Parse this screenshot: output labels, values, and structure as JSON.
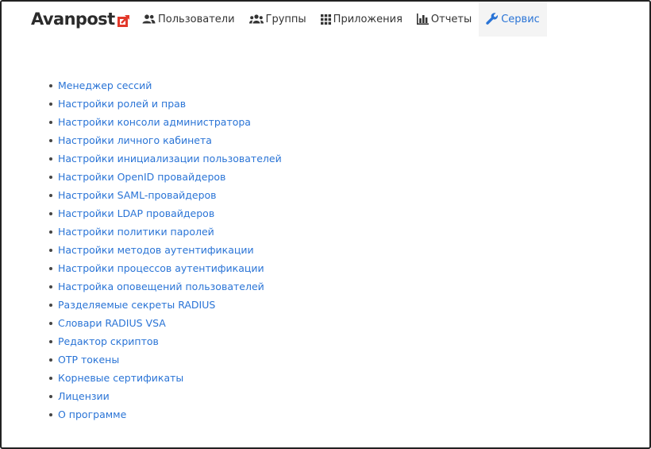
{
  "brand": {
    "name": "Avanpost",
    "accent": "#e2382a"
  },
  "nav": {
    "items": [
      {
        "label": "Пользователи",
        "icon": "users-icon"
      },
      {
        "label": "Группы",
        "icon": "groups-icon"
      },
      {
        "label": "Приложения",
        "icon": "apps-grid-icon"
      },
      {
        "label": "Отчеты",
        "icon": "bar-chart-icon"
      },
      {
        "label": "Сервис",
        "icon": "wrench-icon",
        "active": true
      }
    ],
    "active_color": "#2a74d6"
  },
  "service_menu": {
    "items": [
      "Менеджер сессий",
      "Настройки ролей и прав",
      "Настройки консоли администратора",
      "Настройки личного кабинета",
      "Настройки инициализации пользователей",
      "Настройки OpenID провайдеров",
      "Настройки SAML-провайдеров",
      "Настройки LDAP провайдеров",
      "Настройки политики паролей",
      "Настройки методов аутентификации",
      "Настройки процессов аутентификации",
      "Настройка оповещений пользователей",
      "Разделяемые секреты RADIUS",
      "Словари RADIUS VSA",
      "Редактор скриптов",
      "OTP токены",
      "Корневые сертификаты",
      "Лицензии",
      "О программе"
    ],
    "link_color": "#2a74d6"
  }
}
